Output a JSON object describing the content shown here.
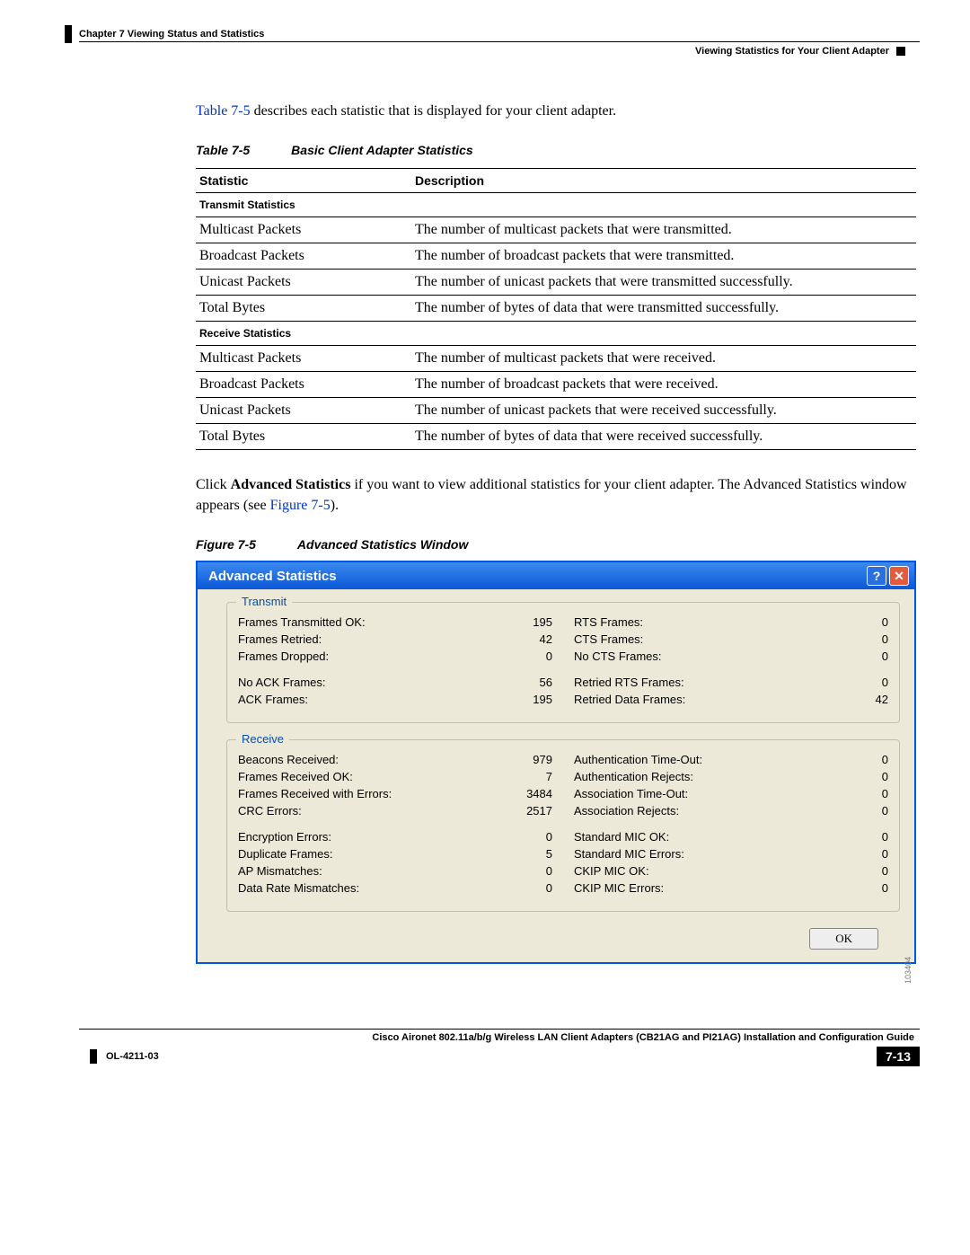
{
  "header": {
    "chapter": "Chapter 7      Viewing Status and Statistics",
    "section": "Viewing Statistics for Your Client Adapter"
  },
  "intro": {
    "link": "Table 7-5",
    "rest": " describes each statistic that is displayed for your client adapter."
  },
  "tableCaption": {
    "num": "Table 7-5",
    "title": "Basic Client Adapter Statistics"
  },
  "th": {
    "c1": "Statistic",
    "c2": "Description"
  },
  "sub1": "Transmit Statistics",
  "rows1": [
    {
      "s": "Multicast Packets",
      "d": "The number of multicast packets that were transmitted."
    },
    {
      "s": "Broadcast Packets",
      "d": "The number of broadcast packets that were transmitted."
    },
    {
      "s": "Unicast Packets",
      "d": "The number of unicast packets that were transmitted successfully."
    },
    {
      "s": "Total Bytes",
      "d": "The number of bytes of data that were transmitted successfully."
    }
  ],
  "sub2": "Receive Statistics",
  "rows2": [
    {
      "s": "Multicast Packets",
      "d": "The number of multicast packets that were received."
    },
    {
      "s": "Broadcast Packets",
      "d": "The number of broadcast packets that were received."
    },
    {
      "s": "Unicast Packets",
      "d": "The number of unicast packets that were received successfully."
    },
    {
      "s": "Total Bytes",
      "d": "The number of bytes of data that were received successfully."
    }
  ],
  "para2": {
    "pre": "Click ",
    "bold": "Advanced Statistics",
    "mid": " if you want to view additional statistics for your client adapter. The Advanced Statistics window appears (see ",
    "link": "Figure 7-5",
    "post": ")."
  },
  "figCaption": {
    "num": "Figure 7-5",
    "title": "Advanced Statistics Window"
  },
  "win": {
    "title": "Advanced Statistics",
    "help": "?",
    "close": "✕",
    "ok": "OK",
    "id": "103404"
  },
  "tx": {
    "title": "Transmit",
    "left": [
      {
        "l": "Frames Transmitted OK:",
        "v": "195"
      },
      {
        "l": "Frames Retried:",
        "v": "42"
      },
      {
        "l": "Frames Dropped:",
        "v": "0"
      },
      {
        "l": "",
        "v": ""
      },
      {
        "l": "No ACK Frames:",
        "v": "56"
      },
      {
        "l": "ACK Frames:",
        "v": "195"
      }
    ],
    "right": [
      {
        "l": "RTS Frames:",
        "v": "0"
      },
      {
        "l": "CTS Frames:",
        "v": "0"
      },
      {
        "l": "No CTS Frames:",
        "v": "0"
      },
      {
        "l": "",
        "v": ""
      },
      {
        "l": "Retried RTS Frames:",
        "v": "0"
      },
      {
        "l": "Retried Data Frames:",
        "v": "42"
      }
    ]
  },
  "rx": {
    "title": "Receive",
    "left": [
      {
        "l": "Beacons Received:",
        "v": "979"
      },
      {
        "l": "Frames Received OK:",
        "v": "7"
      },
      {
        "l": "Frames Received with Errors:",
        "v": "3484"
      },
      {
        "l": "CRC Errors:",
        "v": "2517"
      },
      {
        "l": "",
        "v": ""
      },
      {
        "l": "Encryption Errors:",
        "v": "0"
      },
      {
        "l": "Duplicate Frames:",
        "v": "5"
      },
      {
        "l": "AP Mismatches:",
        "v": "0"
      },
      {
        "l": "Data Rate Mismatches:",
        "v": "0"
      }
    ],
    "right": [
      {
        "l": "Authentication Time-Out:",
        "v": "0"
      },
      {
        "l": "Authentication Rejects:",
        "v": "0"
      },
      {
        "l": "Association Time-Out:",
        "v": "0"
      },
      {
        "l": "Association Rejects:",
        "v": "0"
      },
      {
        "l": "",
        "v": ""
      },
      {
        "l": "Standard MIC OK:",
        "v": "0"
      },
      {
        "l": "Standard MIC Errors:",
        "v": "0"
      },
      {
        "l": "CKIP MIC OK:",
        "v": "0"
      },
      {
        "l": "CKIP MIC Errors:",
        "v": "0"
      }
    ]
  },
  "footer": {
    "guide": "Cisco Aironet 802.11a/b/g Wireless LAN Client Adapters (CB21AG and PI21AG) Installation and Configuration Guide",
    "docid": "OL-4211-03",
    "page": "7-13"
  }
}
